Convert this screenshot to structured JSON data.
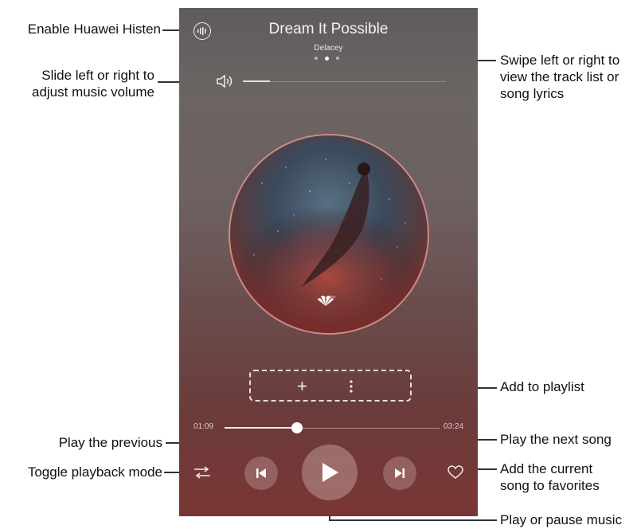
{
  "player": {
    "song_title": "Dream It Possible",
    "artist": "Delacey",
    "current_time": "01:09",
    "total_time": "03:24",
    "progress_fraction": 0.338,
    "volume_fraction": 0.13,
    "active_page_dot": 1,
    "page_dots": 3,
    "album_logo_text": "HUAWEI"
  },
  "icons": {
    "histen": "histen-icon",
    "volume": "volume-icon",
    "add": "plus-icon",
    "more": "more-vertical-icon",
    "play_mode": "shuffle-icon",
    "previous": "previous-track-icon",
    "play": "play-icon",
    "next": "next-track-icon",
    "favorite": "heart-icon"
  },
  "callouts": {
    "histen": "Enable Huawei Histen",
    "volume_line1": "Slide left or right to",
    "volume_line2": "adjust music volume",
    "swipe_line1": "Swipe left or right to",
    "swipe_line2": "view the track list or",
    "swipe_line3": "song lyrics",
    "add_playlist": "Add to playlist",
    "previous": "Play the previous",
    "next": "Play the next song",
    "mode": "Toggle playback mode",
    "favorites_line1": "Add the current",
    "favorites_line2": "song to favorites",
    "play_pause": "Play or pause music"
  },
  "colors": {
    "callout_line": "#333333",
    "accent_thumb": "#ffffff"
  }
}
